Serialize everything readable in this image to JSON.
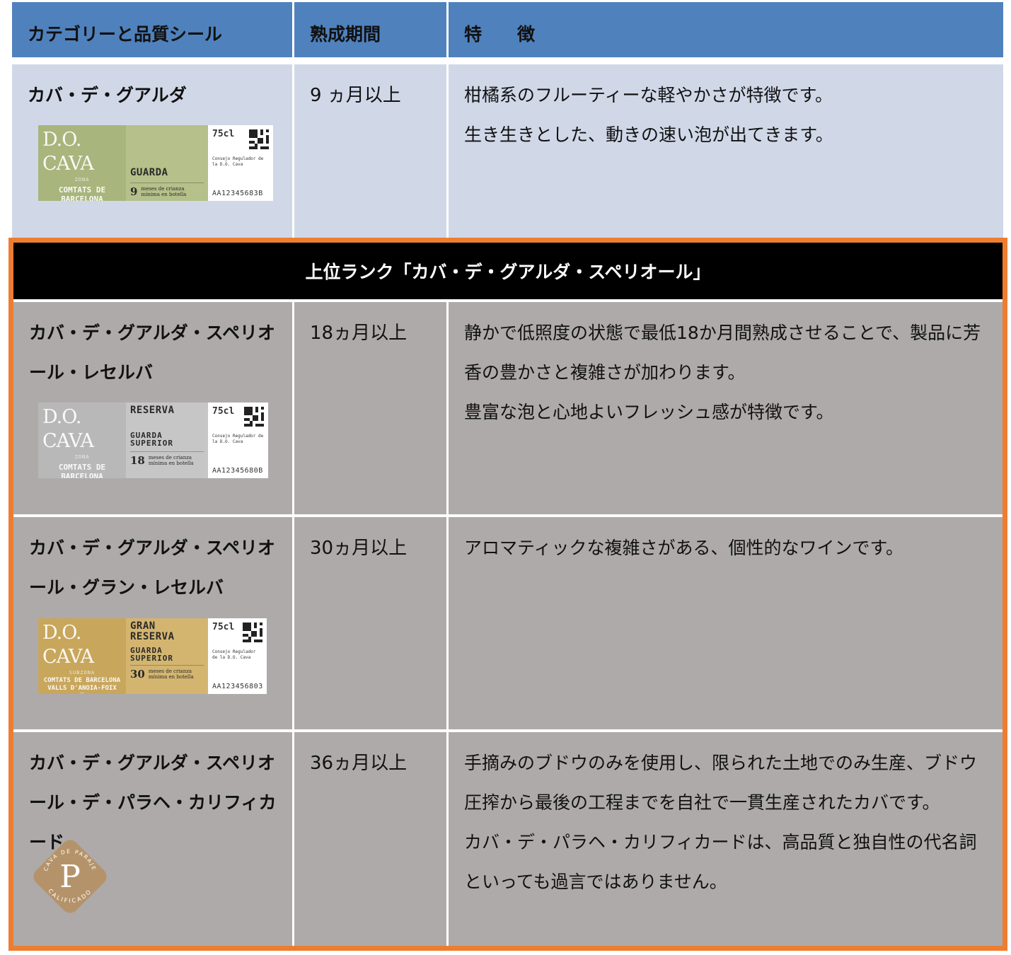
{
  "header": {
    "category": "カテゴリーと品質シール",
    "period": "熟成期間",
    "features": "特　　徴"
  },
  "rows": [
    {
      "name": "カバ・デ・グアルダ",
      "period": "9 ヵ月以上",
      "features": [
        "柑橘系のフルーティーな軽やかさが特徴です。",
        "生き生きとした、動きの速い泡が出てきます。"
      ],
      "seal": {
        "brand": "D.O. CAVA",
        "zona": "ZONA",
        "region": "COMTATS DE BARCELONA",
        "grade": "GUARDA",
        "months": "9",
        "months_text": "meses de crianza mínima en botella",
        "volume": "75cl",
        "consejo": "Consejo Regulador de la D.O. Cava",
        "code": "AA12345683B"
      }
    },
    {
      "name": "カバ・デ・グアルダ・スペリオール・レセルバ",
      "period": "18ヵ月以上",
      "features": [
        "静かで低照度の状態で最低18か月間熟成させることで、製品に芳香の豊かさと複雑さが加わります。",
        "豊富な泡と心地よいフレッシュ感が特徴です。"
      ],
      "seal": {
        "brand": "D.O. CAVA",
        "zona": "ZONA",
        "region": "COMTATS DE BARCELONA",
        "grade": "RESERVA",
        "grade2": "GUARDA SUPERIOR",
        "months": "18",
        "months_text": "meses de crianza mínima en botella",
        "volume": "75cl",
        "consejo": "Consejo Regulador de la D.O. Cava",
        "code": "AA12345680B"
      }
    },
    {
      "name": "カバ・デ・グアルダ・スペリオール・グラン・レセルバ",
      "period": "30ヵ月以上",
      "features": [
        "アロマティックな複雑さがある、個性的なワインです。"
      ],
      "seal": {
        "brand": "D.O. CAVA",
        "zona": "SUBZONA",
        "region": "COMTATS DE BARCELONA VALLS D'ANOIA-FOIX",
        "grade": "GRAN RESERVA",
        "grade2": "GUARDA SUPERIOR",
        "months": "30",
        "months_text": "meses de crianza mínima en botella",
        "volume": "75cl",
        "consejo": "Consejo Regulador de la D.O. Cava",
        "code": "AA123456803"
      }
    },
    {
      "name": "カバ・デ・グアルダ・スペリオール・デ・パラヘ・カリフィカード",
      "period": "36ヵ月以上",
      "features": [
        "手摘みのブドウのみを使用し、限られた土地でのみ生産、ブドウ圧搾から最後の工程までを自社で一貫生産されたカバです。",
        "カバ・デ・パラヘ・カリフィカードは、高品質と独自性の代名詞といっても過言ではありません。"
      ],
      "badge": {
        "top": "CAVA DE PARAJE",
        "letter": "P",
        "bottom": "CALIFICADO"
      }
    }
  ],
  "superior_band": "上位ランク「カバ・デ・グアルダ・スペリオール」",
  "colors": {
    "header_blue": "#4f81bd",
    "row_blue": "#d0d8e8",
    "row_gray": "#aeaaaa",
    "frame_orange": "#ed7d31",
    "seal_green": "#a8b57c",
    "seal_silver": "#b8b8b8",
    "seal_gold": "#c8a65c",
    "badge_bronze": "#b5936a"
  }
}
